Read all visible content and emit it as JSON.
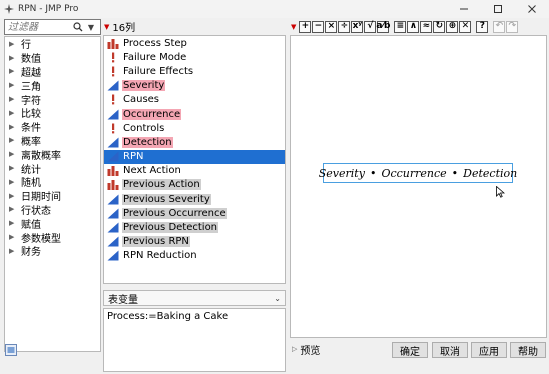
{
  "window": {
    "title": "RPN - JMP Pro",
    "controls": [
      "minimize",
      "maximize",
      "close"
    ]
  },
  "filter": {
    "placeholder": "过滤器"
  },
  "categories": [
    "行",
    "数值",
    "超越",
    "三角",
    "字符",
    "比较",
    "条件",
    "概率",
    "离散概率",
    "统计",
    "随机",
    "日期时间",
    "行状态",
    "赋值",
    "参数模型",
    "财务"
  ],
  "columns": {
    "count_label": "16列",
    "items": [
      {
        "name": "Process Step",
        "type": "nominal-icon",
        "highlight": "none"
      },
      {
        "name": "Failure Mode",
        "type": "unstructured-text-icon",
        "highlight": "none"
      },
      {
        "name": "Failure Effects",
        "type": "unstructured-text-icon",
        "highlight": "none"
      },
      {
        "name": "Severity",
        "type": "continuous-icon",
        "highlight": "pink"
      },
      {
        "name": "Causes",
        "type": "unstructured-text-icon",
        "highlight": "none"
      },
      {
        "name": "Occurrence",
        "type": "continuous-icon",
        "highlight": "pink"
      },
      {
        "name": "Controls",
        "type": "unstructured-text-icon",
        "highlight": "none"
      },
      {
        "name": "Detection",
        "type": "continuous-icon",
        "highlight": "pink"
      },
      {
        "name": "RPN",
        "type": "continuous-icon",
        "highlight": "selected"
      },
      {
        "name": "Next Action",
        "type": "nominal-icon",
        "highlight": "none"
      },
      {
        "name": "Previous Action",
        "type": "nominal-icon",
        "highlight": "gray"
      },
      {
        "name": "Previous Severity",
        "type": "continuous-icon",
        "highlight": "gray"
      },
      {
        "name": "Previous Occurrence",
        "type": "continuous-icon",
        "highlight": "gray"
      },
      {
        "name": "Previous Detection",
        "type": "continuous-icon",
        "highlight": "gray"
      },
      {
        "name": "Previous RPN",
        "type": "continuous-icon",
        "highlight": "gray"
      },
      {
        "name": "RPN Reduction",
        "type": "continuous-icon",
        "highlight": "none"
      }
    ]
  },
  "table_vars": {
    "label": "表变量",
    "content": "Process:=Baking a Cake"
  },
  "toolbar": {
    "buttons": [
      "+",
      "−",
      "×",
      "÷",
      "xʸ",
      "√",
      "a⁄b",
      "≡",
      "∧",
      "≈",
      "↻",
      "⊕",
      "✕",
      "?",
      "↶",
      "↷"
    ]
  },
  "formula": {
    "terms": [
      "Severity",
      "Occurrence",
      "Detection"
    ],
    "operator": "•"
  },
  "preview": {
    "label": "预览"
  },
  "buttons": {
    "ok": "确定",
    "cancel": "取消",
    "apply": "应用",
    "help": "帮助"
  },
  "colors": {
    "selection": "#1f6fd1",
    "pink_highlight": "#f4a6b3",
    "gray_highlight": "#cfcfcf",
    "formula_border": "#4a9fe0"
  }
}
